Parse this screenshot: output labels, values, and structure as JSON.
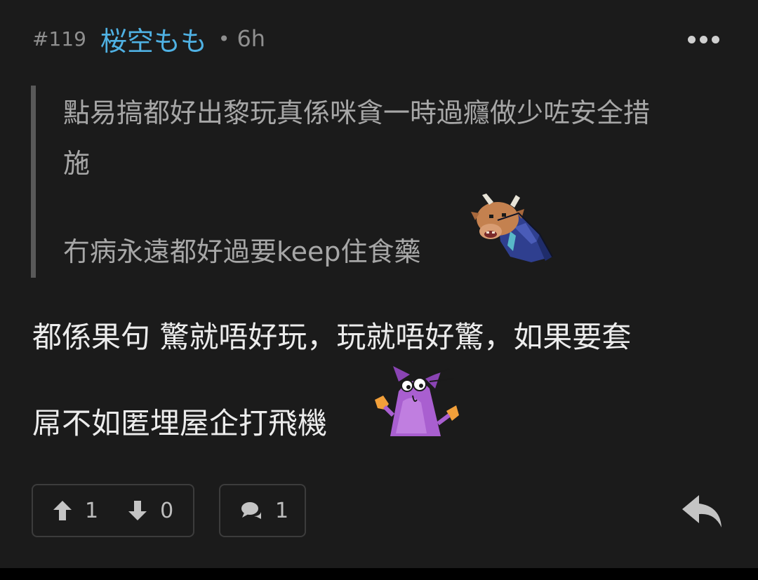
{
  "post": {
    "floor": "#119",
    "username": "桜空もも",
    "separator": "•",
    "time": "6h"
  },
  "quote": {
    "line1": "點易搞都好出黎玩真係咪貪一時過癮做少咗安全措",
    "line2": "施",
    "line3": "冇病永遠都好過要keep住食藥"
  },
  "body": {
    "line1": "都係果句 驚就唔好玩，玩就唔好驚，如果要套",
    "line2": "屌不如匿埋屋企打飛機"
  },
  "actions": {
    "upvotes": "1",
    "downvotes": "0",
    "comments": "1"
  },
  "icons": {
    "more": "more-dots-icon",
    "upvote": "arrow-up-icon",
    "downvote": "arrow-down-icon",
    "comment": "comment-bubble-icon",
    "reply": "reply-arrow-icon",
    "sticker_quote": "bull-in-suit-sticker",
    "sticker_body": "purple-cat-sticker"
  },
  "colors": {
    "background": "#1b1b1b",
    "username": "#4fb1e3",
    "quote_bar": "#595959"
  }
}
